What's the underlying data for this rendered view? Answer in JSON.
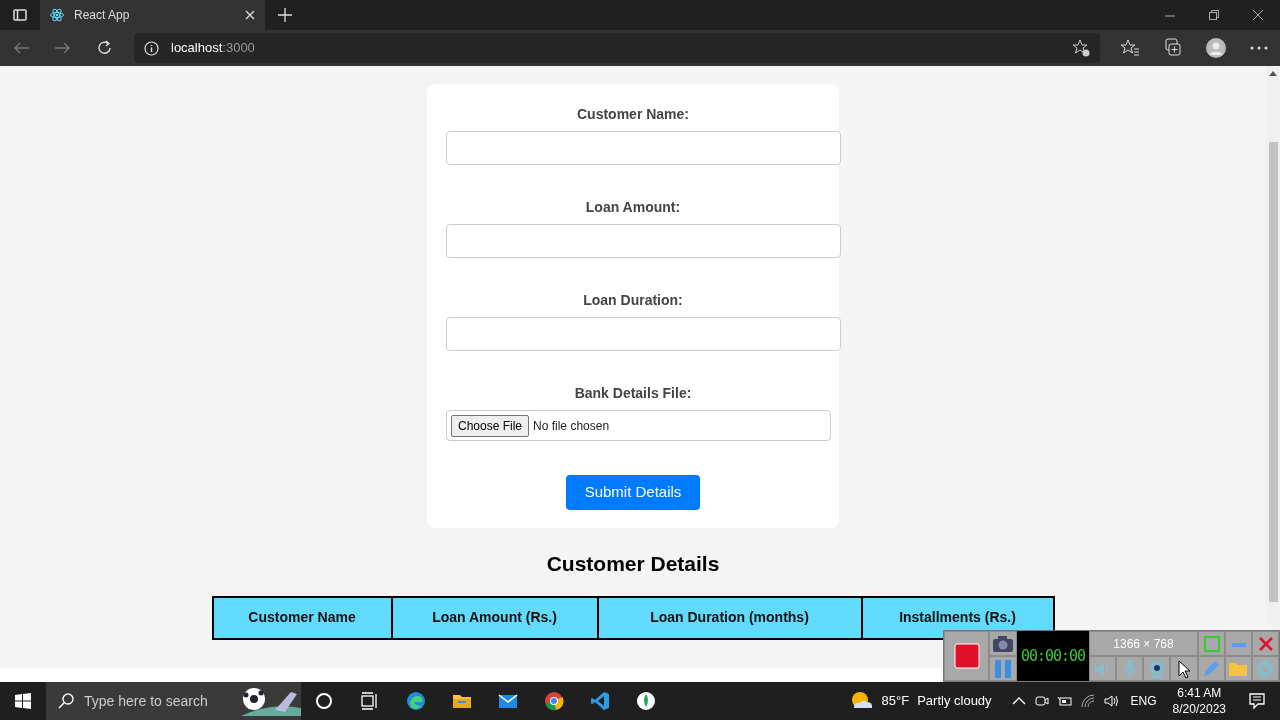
{
  "browser": {
    "tab_title": "React App",
    "address_host": "localhost",
    "address_port": ":3000"
  },
  "form": {
    "fields": [
      {
        "label": "Customer Name:",
        "kind": "text"
      },
      {
        "label": "Loan Amount:",
        "kind": "text"
      },
      {
        "label": "Loan Duration:",
        "kind": "text"
      },
      {
        "label": "Bank Details File:",
        "kind": "file",
        "button": "Choose File",
        "status": "No file chosen"
      }
    ],
    "submit": "Submit Details"
  },
  "table": {
    "title": "Customer Details",
    "columns": [
      "Customer Name",
      "Loan Amount (Rs.)",
      "Loan Duration (months)",
      "Installments (Rs.)"
    ]
  },
  "recorder": {
    "timer": "00:00:00",
    "resolution": "1366 × 768"
  },
  "taskbar": {
    "search_placeholder": "Type here to search",
    "temperature": "85°F",
    "weather": "Partly cloudy",
    "language": "ENG",
    "time": "6:41 AM",
    "date": "8/20/2023"
  }
}
